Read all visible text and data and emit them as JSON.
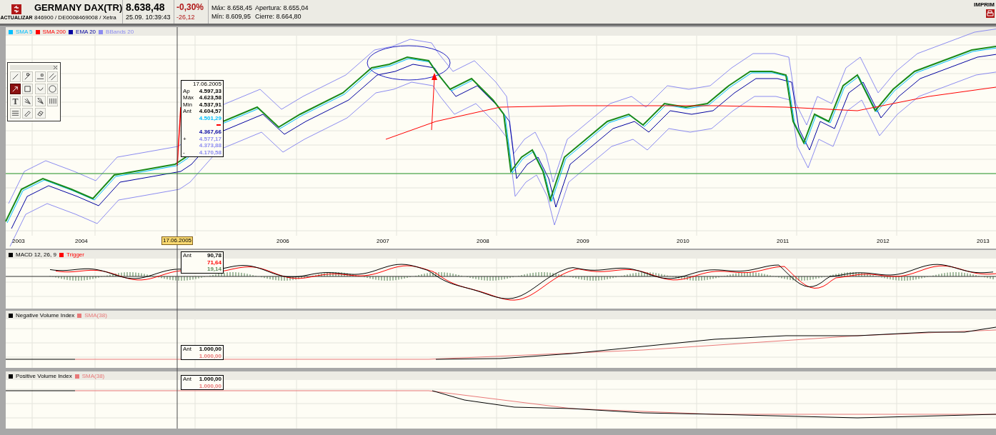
{
  "header": {
    "refresh_label": "ACTUALIZAR",
    "name": "GERMANY DAX(TR)",
    "ids": "846900 / DE0008469008 / Xetra",
    "price": "8.638,48",
    "datetime": "25.09. 10:39:43",
    "change_pct": "-0,30%",
    "change_abs": "-26,12",
    "stats": [
      {
        "label": "Máx:",
        "value": "8.658,45"
      },
      {
        "label": "Apertura:",
        "value": "8.655,04"
      },
      {
        "label": "Mín:",
        "value": "8.609,95"
      },
      {
        "label": "Cierre:",
        "value": "8.664,80"
      }
    ],
    "print_label": "IMPRIM"
  },
  "price_panel": {
    "legend": [
      {
        "label": "SMA 5",
        "color": "#00bfff"
      },
      {
        "label": "SMA 200",
        "color": "#ff0000"
      },
      {
        "label": "EMA 20",
        "color": "#0000a0"
      },
      {
        "label": "BBands 20",
        "color": "#8c8cf0"
      }
    ],
    "tooltip": {
      "date": "17.06.2005",
      "rows": [
        {
          "label": "Ap",
          "value": "4.597,33",
          "color": "#000000"
        },
        {
          "label": "Máx",
          "value": "4.623,58",
          "color": "#000000"
        },
        {
          "label": "Min",
          "value": "4.537,91",
          "color": "#000000"
        },
        {
          "label": "Ant",
          "value": "4.604,57",
          "color": "#000000"
        },
        {
          "value": "4.501,29",
          "color": "#00bfff"
        },
        {
          "kind": "marker",
          "color": "#ff0000"
        },
        {
          "value": "4.367,66",
          "color": "#0000a0"
        },
        {
          "label": "+",
          "value": "4.577,17",
          "color": "#8c8cf0"
        },
        {
          "value": "4.373,88",
          "color": "#8c8cf0"
        },
        {
          "label": "-",
          "value": "4.170,58",
          "color": "#8c8cf0"
        }
      ]
    }
  },
  "toolbox": {
    "tools": [
      {
        "kind": "line",
        "selected": false
      },
      {
        "kind": "line-label",
        "selected": false
      },
      {
        "kind": "hline-label",
        "selected": false
      },
      {
        "kind": "parallel",
        "selected": false
      },
      {
        "kind": "arrow",
        "selected": true
      },
      {
        "kind": "rectangle",
        "selected": false
      },
      {
        "kind": "arc",
        "selected": false
      },
      {
        "kind": "circle",
        "selected": false
      },
      {
        "kind": "text",
        "glyph": "T",
        "selected": false
      },
      {
        "kind": "fan",
        "selected": false
      },
      {
        "kind": "fan2",
        "selected": false
      },
      {
        "kind": "vlines",
        "selected": false
      },
      {
        "kind": "hlines",
        "selected": false
      },
      {
        "kind": "brush",
        "selected": false
      },
      {
        "kind": "eraser",
        "selected": false
      }
    ]
  },
  "x_axis": {
    "years": [
      "2003",
      "2004",
      "2006",
      "2007",
      "2008",
      "2009",
      "2010",
      "2011",
      "2012",
      "2013"
    ],
    "cursor_label": "17.06.2005"
  },
  "macd_panel": {
    "legend": [
      {
        "label": "MACD 12, 26, 9",
        "color": "#000000"
      },
      {
        "label": "Trigger",
        "color": "#ff0000"
      }
    ],
    "tooltip": {
      "label": "Ant",
      "values": [
        {
          "value": "90,78",
          "color": "#000000"
        },
        {
          "value": "71,64",
          "color": "#ff0000"
        },
        {
          "value": "19,14",
          "color": "#5a8a5a"
        }
      ]
    }
  },
  "nvi_panel": {
    "legend": [
      {
        "label": "Negative Volume Index",
        "color": "#000000"
      },
      {
        "label": "SMA(38)",
        "color": "#e87878"
      }
    ],
    "tooltip": {
      "label": "Ant",
      "values": [
        {
          "value": "1.000,00",
          "color": "#000000"
        },
        {
          "value": "1.000,00",
          "color": "#e87878"
        }
      ]
    }
  },
  "pvi_panel": {
    "legend": [
      {
        "label": "Positive Volume Index",
        "color": "#000000"
      },
      {
        "label": "SMA(38)",
        "color": "#e87878"
      }
    ],
    "tooltip": {
      "label": "Ant",
      "values": [
        {
          "value": "1.000,00",
          "color": "#000000"
        },
        {
          "value": "1.000,00",
          "color": "#e87878"
        }
      ]
    }
  }
}
